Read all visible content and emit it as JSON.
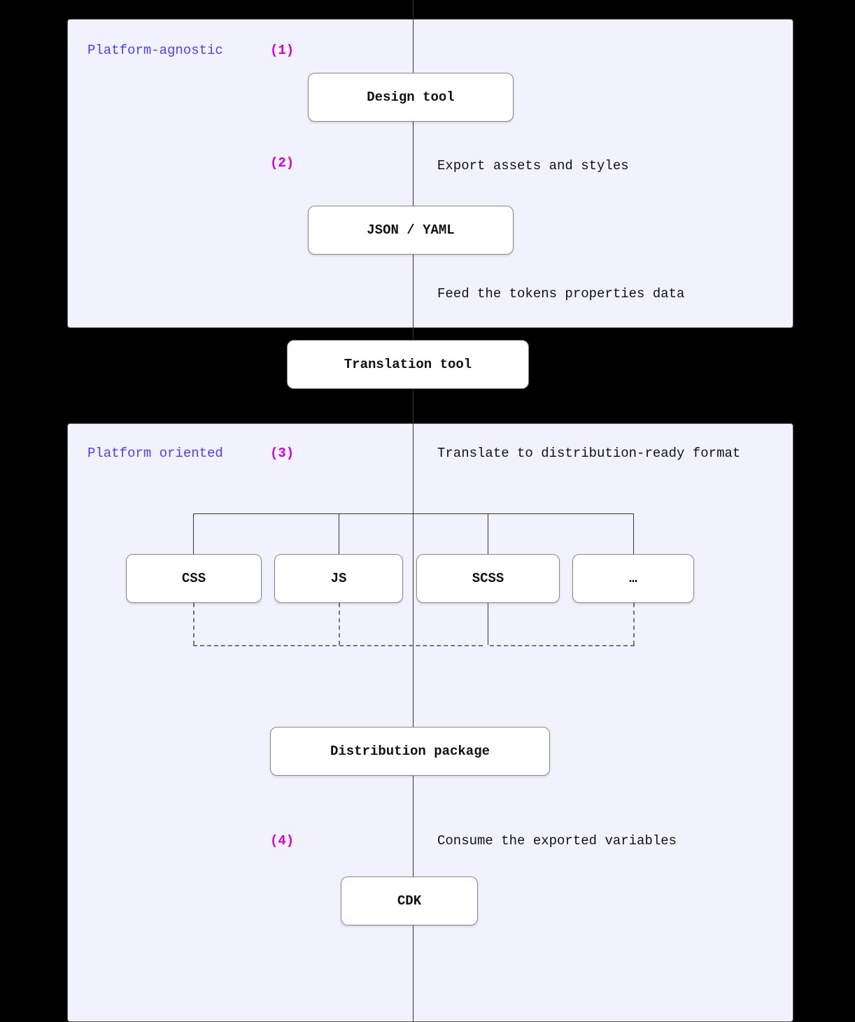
{
  "panels": {
    "top": {
      "label": "Platform-agnostic"
    },
    "bottom": {
      "label": "Platform oriented"
    }
  },
  "steps": {
    "s1": {
      "marker": "(1)",
      "desc": ""
    },
    "s2": {
      "marker": "(2)",
      "desc": "Export assets and styles"
    },
    "s2b": {
      "marker": "",
      "desc": "Feed the tokens properties data"
    },
    "s3": {
      "marker": "(3)",
      "desc": "Translate to distribution-ready format"
    },
    "s4": {
      "marker": "(4)",
      "desc": "Consume the exported variables"
    }
  },
  "nodes": {
    "design": "Design tool",
    "json": "JSON / YAML",
    "trans": "Translation tool",
    "css": "CSS",
    "js": "JS",
    "scss": "SCSS",
    "etc": "…",
    "dist": "Distribution package",
    "cdk": "CDK"
  }
}
